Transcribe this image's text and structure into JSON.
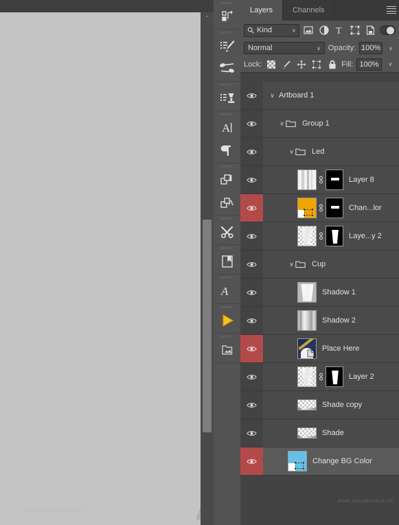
{
  "panel": {
    "tabs": [
      {
        "label": "Layers",
        "active": true
      },
      {
        "label": "Channels",
        "active": false
      }
    ],
    "menu_icon": "hamburger-menu-icon",
    "filter": {
      "kind_label": "Kind",
      "search_icon": "search-icon",
      "chevron": "∨",
      "icons": [
        {
          "name": "pixel-layer-filter-icon",
          "title": "Pixel layers"
        },
        {
          "name": "adjustment-layer-filter-icon",
          "title": "Adjustment layers"
        },
        {
          "name": "type-layer-filter-icon",
          "title": "Type layers"
        },
        {
          "name": "shape-layer-filter-icon",
          "title": "Shape layers"
        },
        {
          "name": "smart-object-filter-icon",
          "title": "Smart objects"
        }
      ],
      "toggle_name": "filter-enable-toggle"
    },
    "blend": {
      "mode": "Normal",
      "opacity_label": "Opacity:",
      "opacity_value": "100%"
    },
    "lock": {
      "label": "Lock:",
      "icons": [
        {
          "name": "lock-transparent-pixels-icon"
        },
        {
          "name": "lock-image-pixels-icon"
        },
        {
          "name": "lock-position-icon"
        },
        {
          "name": "lock-artboard-nesting-icon"
        },
        {
          "name": "lock-all-icon"
        }
      ],
      "fill_label": "Fill:",
      "fill_value": "100%"
    },
    "watermark": "WWW.FREEMOCKUP.VN"
  },
  "layers": [
    {
      "name": "Artboard 1",
      "indent": 0,
      "type": "artboard",
      "disclosure": "∨",
      "visible": true,
      "flagged": false,
      "selected": false,
      "thumb": "none",
      "mask": false,
      "linked": false
    },
    {
      "name": "Group 1",
      "indent": 1,
      "type": "group",
      "disclosure": "∨",
      "visible": true,
      "flagged": false,
      "selected": false,
      "thumb": "none",
      "mask": false,
      "linked": false
    },
    {
      "name": "Led",
      "indent": 2,
      "type": "group",
      "disclosure": "∨",
      "visible": true,
      "flagged": false,
      "selected": false,
      "thumb": "none",
      "mask": false,
      "linked": false
    },
    {
      "name": "Layer 8",
      "indent": 3,
      "type": "layer",
      "disclosure": "",
      "visible": true,
      "flagged": false,
      "selected": false,
      "thumb": "stripes",
      "mask": true,
      "linked": true
    },
    {
      "name": "Chan...lor",
      "indent": 3,
      "type": "layer",
      "disclosure": "",
      "visible": true,
      "flagged": true,
      "selected": false,
      "thumb": "orange",
      "mask": true,
      "linked": true
    },
    {
      "name": "Laye...y 2",
      "indent": 3,
      "type": "layer",
      "disclosure": "",
      "visible": true,
      "flagged": false,
      "selected": false,
      "thumb": "cup-alpha",
      "mask": true,
      "linked": true
    },
    {
      "name": "Cup",
      "indent": 2,
      "type": "group",
      "disclosure": "∨",
      "visible": true,
      "flagged": false,
      "selected": false,
      "thumb": "none",
      "mask": false,
      "linked": false
    },
    {
      "name": "Shadow 1",
      "indent": 3,
      "type": "layer",
      "disclosure": "",
      "visible": true,
      "flagged": false,
      "selected": false,
      "thumb": "cup-white",
      "mask": false,
      "linked": false
    },
    {
      "name": "Shadow 2",
      "indent": 3,
      "type": "layer",
      "disclosure": "",
      "visible": true,
      "flagged": false,
      "selected": false,
      "thumb": "cup-gray",
      "mask": false,
      "linked": false
    },
    {
      "name": "Place Here",
      "indent": 3,
      "type": "smart",
      "disclosure": "",
      "visible": true,
      "flagged": true,
      "selected": false,
      "thumb": "artwork",
      "mask": false,
      "linked": false
    },
    {
      "name": "Layer 2",
      "indent": 3,
      "type": "layer",
      "disclosure": "",
      "visible": true,
      "flagged": false,
      "selected": false,
      "thumb": "cup-alpha",
      "mask": true,
      "linked": true
    },
    {
      "name": "Shade copy",
      "indent": 3,
      "type": "layer",
      "disclosure": "",
      "visible": true,
      "flagged": false,
      "selected": false,
      "thumb": "shade-bar",
      "mask": false,
      "linked": false
    },
    {
      "name": "Shade",
      "indent": 3,
      "type": "layer",
      "disclosure": "",
      "visible": true,
      "flagged": false,
      "selected": false,
      "thumb": "shade-bar",
      "mask": false,
      "linked": false
    },
    {
      "name": "Change BG Color",
      "indent": 2,
      "type": "smart",
      "disclosure": "",
      "visible": true,
      "flagged": true,
      "selected": true,
      "thumb": "blue-bg",
      "mask": false,
      "linked": false
    }
  ],
  "toolbar": {
    "groups": [
      {
        "tools": [
          {
            "name": "artboard-tool",
            "active": false
          }
        ]
      },
      {
        "tools": [
          {
            "name": "brush-tool",
            "active": false
          },
          {
            "name": "mixer-brush-tool",
            "active": false
          }
        ]
      },
      {
        "tools": [
          {
            "name": "clone-stamp-tool",
            "active": false
          }
        ]
      },
      {
        "tools": [
          {
            "name": "horizontal-type-tool",
            "active": false
          },
          {
            "name": "paragraph-tool",
            "active": false
          }
        ]
      },
      {
        "tools": [
          {
            "name": "layer-shape-tool",
            "active": false
          },
          {
            "name": "layer-type-tool",
            "active": false
          }
        ]
      },
      {
        "tools": [
          {
            "name": "edit-toolbar-tool",
            "active": false
          }
        ]
      },
      {
        "tools": [
          {
            "name": "notes-tool",
            "active": false
          }
        ]
      },
      {
        "tools": [
          {
            "name": "script-type-tool",
            "active": false
          }
        ]
      },
      {
        "tools": [
          {
            "name": "path-selection-tool",
            "active": true
          }
        ]
      },
      {
        "tools": [
          {
            "name": "place-image-tool",
            "active": false
          }
        ]
      }
    ]
  },
  "document": {
    "canvas_watermark": "ALL FREE MOCKUPS FOR",
    "logo_name": "mockup-logo",
    "scrollbar_name": "canvas-vertical-scrollbar",
    "scroll_up_glyph": "⌃"
  },
  "colors": {
    "panel_bg": "#434343",
    "row_bg": "#4a4a4a",
    "row_selected": "#5a5a5a",
    "flag_red": "#b34a4a",
    "chrome": "#535353",
    "canvas": "#c4c4c4",
    "accent_yellow": "#f0a500",
    "accent_blue": "#66c0e8"
  }
}
